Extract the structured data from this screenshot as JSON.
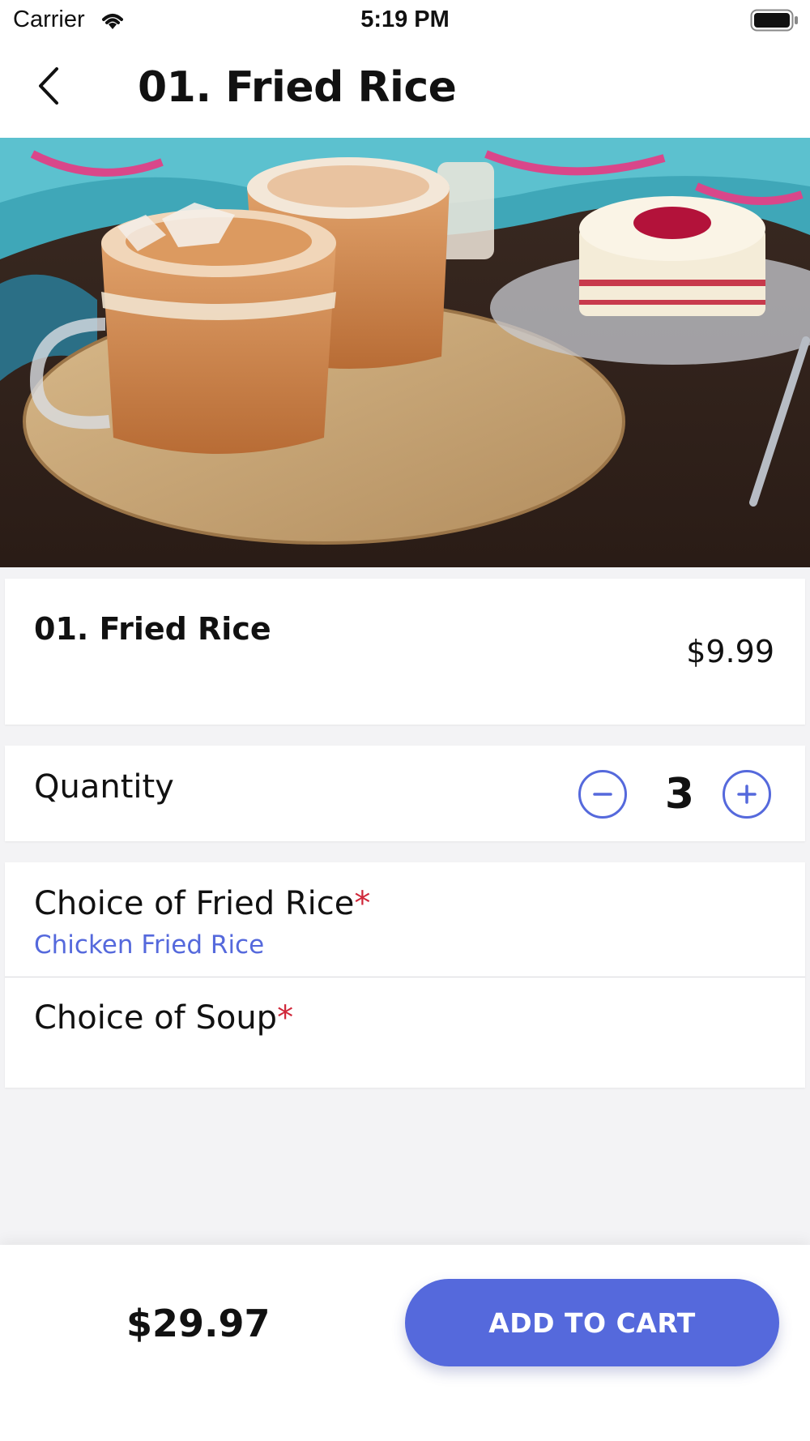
{
  "status_bar": {
    "carrier": "Carrier",
    "time": "5:19 PM"
  },
  "nav": {
    "title": "01. Fried Rice",
    "back_icon": "chevron-left-icon"
  },
  "hero": {
    "image_alt": "Iced milk tea in glass mugs on a wooden board with a slice of cake"
  },
  "item": {
    "name": "01. Fried Rice",
    "price": "$9.99"
  },
  "quantity": {
    "label": "Quantity",
    "value": "3",
    "minus_icon": "minus-circle-icon",
    "plus_icon": "plus-circle-icon"
  },
  "options": [
    {
      "title": "Choice of Fried Rice",
      "required_mark": "*",
      "selected": "Chicken Fried Rice"
    },
    {
      "title": "Choice of Soup",
      "required_mark": "*",
      "selected": ""
    }
  ],
  "footer": {
    "total": "$29.97",
    "add_to_cart_label": "ADD TO CART"
  },
  "colors": {
    "accent": "#5569dc",
    "required": "#d0283a"
  }
}
